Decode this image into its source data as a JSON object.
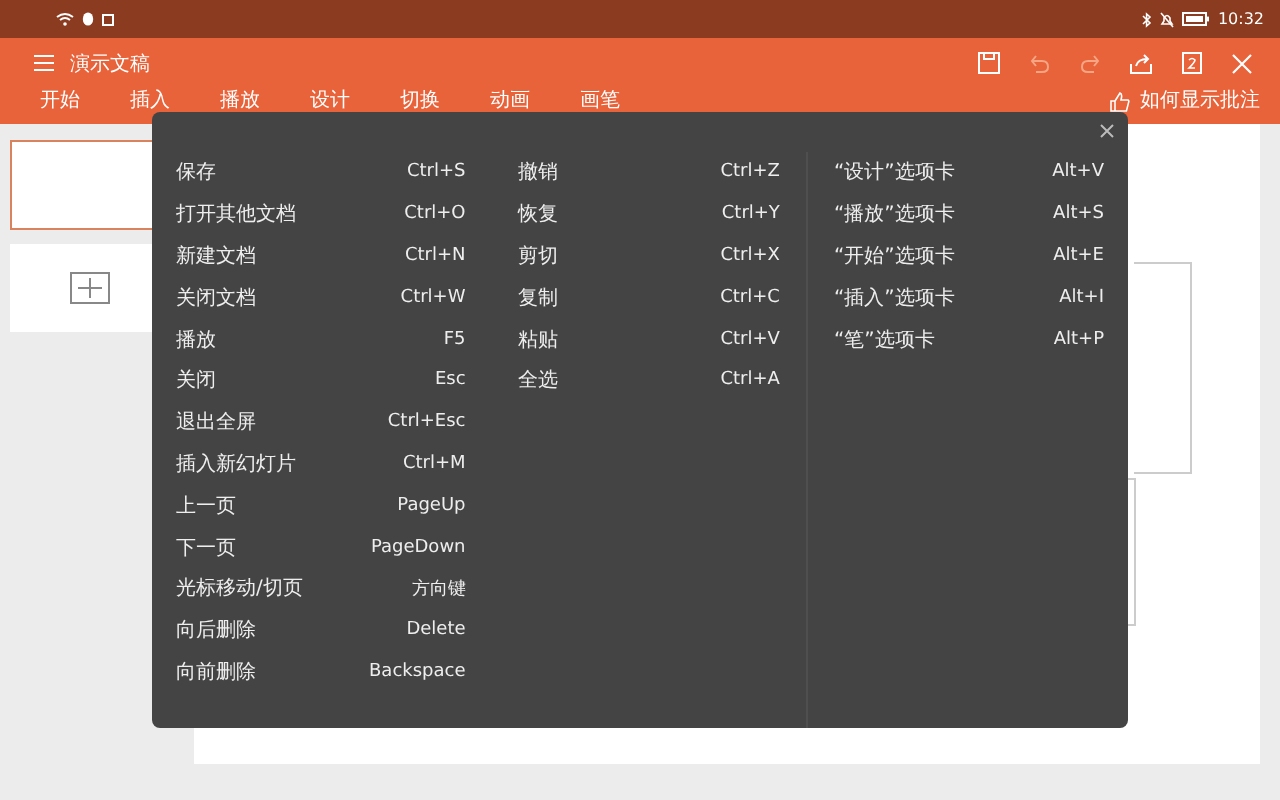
{
  "status_bar": {
    "time": "10:32"
  },
  "window": {
    "title": "演示文稿"
  },
  "tabs": [
    {
      "label": "开始"
    },
    {
      "label": "插入"
    },
    {
      "label": "播放"
    },
    {
      "label": "设计"
    },
    {
      "label": "切换"
    },
    {
      "label": "动画"
    },
    {
      "label": "画笔"
    }
  ],
  "comment_hint": "如何显示批注",
  "shortcuts": {
    "columns": [
      [
        {
          "action": "保存",
          "keys": "Ctrl+S"
        },
        {
          "action": "打开其他文档",
          "keys": "Ctrl+O"
        },
        {
          "action": "新建文档",
          "keys": "Ctrl+N"
        },
        {
          "action": "关闭文档",
          "keys": "Ctrl+W"
        },
        {
          "action": "播放",
          "keys": "F5"
        },
        {
          "action": "关闭",
          "keys": "Esc"
        },
        {
          "action": "退出全屏",
          "keys": "Ctrl+Esc"
        },
        {
          "action": "插入新幻灯片",
          "keys": "Ctrl+M"
        },
        {
          "action": "上一页",
          "keys": "PageUp"
        },
        {
          "action": "下一页",
          "keys": "PageDown"
        },
        {
          "action": "光标移动/切页",
          "keys": "方向键"
        },
        {
          "action": "向后删除",
          "keys": "Delete"
        },
        {
          "action": "向前删除",
          "keys": "Backspace"
        }
      ],
      [
        {
          "action": "撤销",
          "keys": "Ctrl+Z"
        },
        {
          "action": "恢复",
          "keys": "Ctrl+Y"
        },
        {
          "action": "剪切",
          "keys": "Ctrl+X"
        },
        {
          "action": "复制",
          "keys": "Ctrl+C"
        },
        {
          "action": "粘贴",
          "keys": "Ctrl+V"
        },
        {
          "action": "全选",
          "keys": "Ctrl+A"
        }
      ],
      [
        {
          "action": "“设计”选项卡",
          "keys": "Alt+V"
        },
        {
          "action": "“播放”选项卡",
          "keys": "Alt+S"
        },
        {
          "action": "“开始”选项卡",
          "keys": "Alt+E"
        },
        {
          "action": "“插入”选项卡",
          "keys": "Alt+I"
        },
        {
          "action": "“笔”选项卡",
          "keys": "Alt+P"
        }
      ]
    ]
  }
}
